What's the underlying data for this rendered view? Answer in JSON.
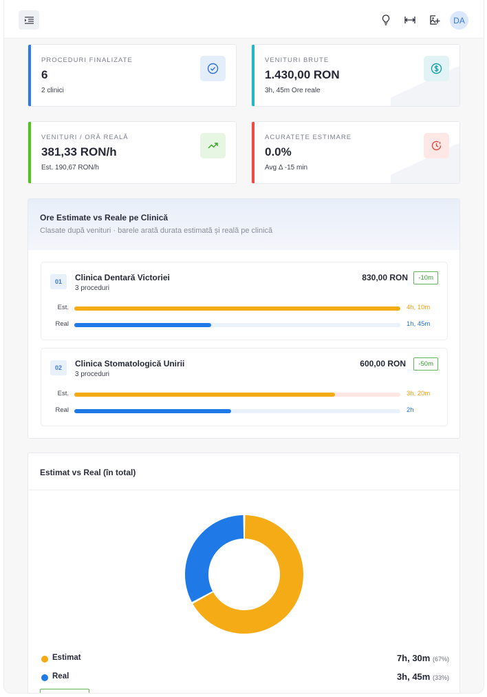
{
  "topbar": {
    "menu_icon": "menu-toggle-icon",
    "icons": [
      "lightbulb-icon",
      "width-expand-icon",
      "image-add-icon"
    ],
    "avatar_initials": "DA"
  },
  "stats": [
    {
      "label": "PROCEDURI FINALIZATE",
      "value": "6",
      "sub": "2 clinici",
      "icon": "check-circle-icon",
      "accent": "#2f7be5"
    },
    {
      "label": "VENITURI BRUTE",
      "value": "1.430,00 RON",
      "sub": "3h, 45m Ore reale",
      "icon": "dollar-circle-icon",
      "accent": "#22b8c4"
    },
    {
      "label": "VENITURI / ORĂ REALĂ",
      "value": "381,33 RON/h",
      "sub": "Est. 190,67 RON/h",
      "icon": "trending-up-icon",
      "accent": "#52c41a"
    },
    {
      "label": "ACURATEȚE ESTIMARE",
      "value": "0.0%",
      "sub": "Avg Δ -15 min",
      "icon": "clock-alert-icon",
      "accent": "#f04b4b"
    }
  ],
  "clinics_panel": {
    "title": "Ore Estimate vs Reale pe Clinică",
    "subtitle": "Clasate după venituri · barele arată durata estimată și reală pe clinică",
    "est_label": "Est.",
    "real_label": "Real",
    "clinics": [
      {
        "rank": "01",
        "name": "Clinica Dentară Victoriei",
        "procedures": "3 proceduri",
        "revenue": "830,00 RON",
        "delta": "-10m",
        "est_text": "4h, 10m",
        "real_text": "1h, 45m",
        "est_fraction": 1.0,
        "real_fraction": 0.42
      },
      {
        "rank": "02",
        "name": "Clinica Stomatologică Unirii",
        "procedures": "3 proceduri",
        "revenue": "600,00 RON",
        "delta": "-50m",
        "est_text": "3h, 20m",
        "real_text": "2h",
        "est_fraction": 0.8,
        "real_fraction": 0.48
      }
    ]
  },
  "totals_panel": {
    "title": "Estimat vs Real (în total)",
    "legend": [
      {
        "name": "Estimat",
        "value": "7h, 30m",
        "pct": "(67%)",
        "color": "#f5ab16"
      },
      {
        "name": "Real",
        "value": "3h, 45m",
        "pct": "(33%)",
        "color": "#1f7ae8"
      }
    ]
  },
  "chart_data": {
    "type": "pie",
    "title": "Estimat vs Real (în total)",
    "categories": [
      "Estimat",
      "Real"
    ],
    "values": [
      67,
      33
    ],
    "colors": [
      "#f5ab16",
      "#1f7ae8"
    ]
  }
}
